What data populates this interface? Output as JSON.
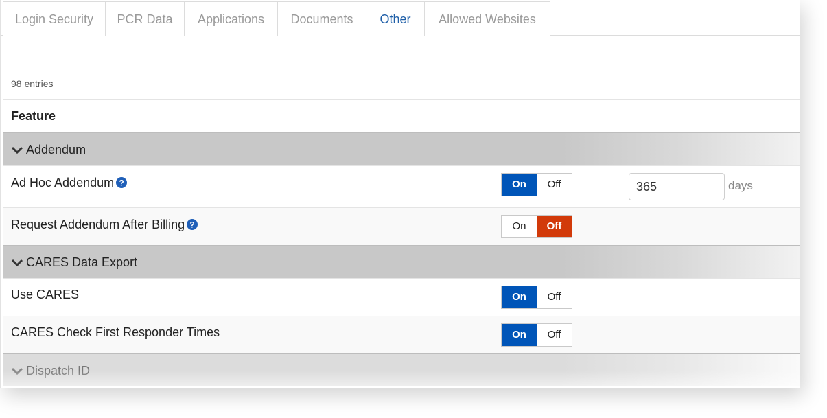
{
  "tabs": [
    {
      "label": "Login Security"
    },
    {
      "label": "PCR Data"
    },
    {
      "label": "Applications"
    },
    {
      "label": "Documents"
    },
    {
      "label": "Other",
      "active": true
    },
    {
      "label": "Allowed Websites"
    }
  ],
  "table": {
    "entries_text": "98 entries",
    "column_header": "Feature",
    "groups": [
      {
        "title": "Addendum",
        "rows": [
          {
            "label": "Ad Hoc Addendum",
            "has_help": true,
            "on_label": "On",
            "off_label": "Off",
            "state": "on",
            "input_value": "365",
            "input_unit": "days"
          },
          {
            "label": "Request Addendum After Billing",
            "has_help": true,
            "on_label": "On",
            "off_label": "Off",
            "state": "off"
          }
        ]
      },
      {
        "title": "CARES Data Export",
        "rows": [
          {
            "label": "Use CARES",
            "on_label": "On",
            "off_label": "Off",
            "state": "on"
          },
          {
            "label": "CARES Check First Responder Times",
            "on_label": "On",
            "off_label": "Off",
            "state": "on"
          }
        ]
      },
      {
        "title": "Dispatch ID",
        "rows": []
      }
    ]
  },
  "icons": {
    "chevron": "chevron-down-icon",
    "help": "question-circle-icon"
  },
  "colors": {
    "active_tab_text": "#1f5fa8",
    "toggle_on": "#0055b8",
    "toggle_off": "#d23a0a",
    "help_icon": "#1f5fb8",
    "group_header": "#c8c8c8"
  }
}
